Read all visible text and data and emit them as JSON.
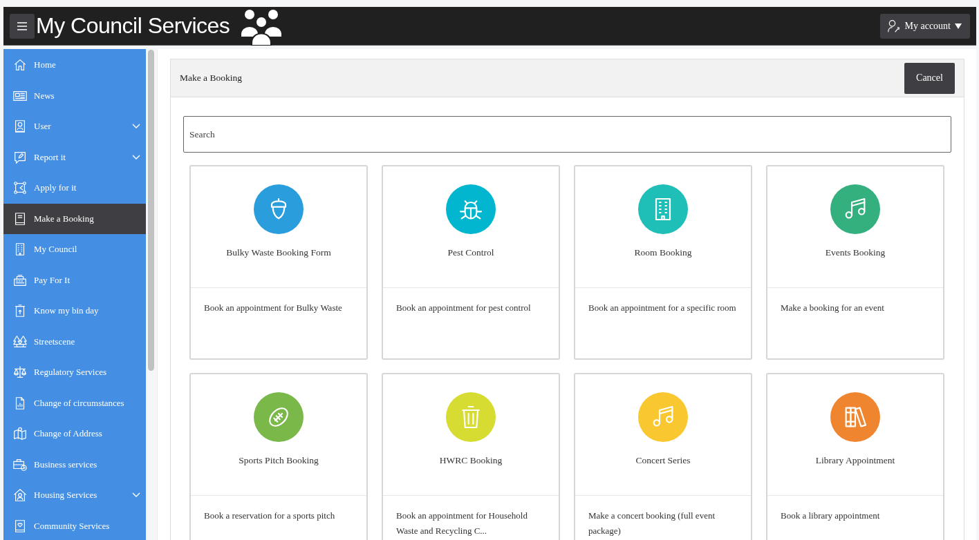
{
  "header": {
    "title": "My Council Services",
    "account_button": "My account"
  },
  "sidebar": {
    "items": [
      {
        "label": "Home",
        "kind": "home",
        "expandable": false,
        "selected": false
      },
      {
        "label": "News",
        "kind": "news",
        "expandable": false,
        "selected": false
      },
      {
        "label": "User",
        "kind": "user",
        "expandable": true,
        "selected": false
      },
      {
        "label": "Report it",
        "kind": "report",
        "expandable": true,
        "selected": false
      },
      {
        "label": "Apply for it",
        "kind": "apply",
        "expandable": false,
        "selected": false
      },
      {
        "label": "Make a Booking",
        "kind": "book",
        "expandable": false,
        "selected": true
      },
      {
        "label": "My Council",
        "kind": "building",
        "expandable": false,
        "selected": false
      },
      {
        "label": "Pay For It",
        "kind": "till",
        "expandable": false,
        "selected": false
      },
      {
        "label": "Know my bin day",
        "kind": "bin",
        "expandable": false,
        "selected": false
      },
      {
        "label": "Streetscene",
        "kind": "trees",
        "expandable": false,
        "selected": false
      },
      {
        "label": "Regulatory Services",
        "kind": "scales",
        "expandable": false,
        "selected": false
      },
      {
        "label": "Change of circumstances",
        "kind": "doc",
        "expandable": false,
        "selected": false
      },
      {
        "label": "Change of Address",
        "kind": "map",
        "expandable": false,
        "selected": false
      },
      {
        "label": "Business services",
        "kind": "briefcase",
        "expandable": false,
        "selected": false
      },
      {
        "label": "Housing Services",
        "kind": "house-user",
        "expandable": true,
        "selected": false
      },
      {
        "label": "Community Services",
        "kind": "heart-book",
        "expandable": false,
        "selected": false
      }
    ]
  },
  "panel": {
    "title": "Make a Booking",
    "cancel_button": "Cancel",
    "search": {
      "placeholder": "Search"
    },
    "cards": [
      {
        "title": "Bulky Waste Booking Form",
        "description": "Book an appointment for Bulky Waste",
        "kind": "acorn",
        "color": "#2a9edc"
      },
      {
        "title": "Pest Control",
        "description": "Book an appointment for pest control",
        "kind": "bug",
        "color": "#03b6cf"
      },
      {
        "title": "Room Booking",
        "description": "Book an appointment for a specific room",
        "kind": "building",
        "color": "#1fbfb8"
      },
      {
        "title": "Events Booking",
        "description": "Make a booking for an event",
        "kind": "music",
        "color": "#33b07e"
      },
      {
        "title": "Sports Pitch Booking",
        "description": "Book a reservation for a sports pitch",
        "kind": "football",
        "color": "#7ab84a"
      },
      {
        "title": "HWRC Booking",
        "description": "Book an appointment for Household Waste and Recycling C...",
        "kind": "trash",
        "color": "#d6dc31"
      },
      {
        "title": "Concert Series",
        "description": "Make a concert booking (full event package)",
        "kind": "music",
        "color": "#f9c72f"
      },
      {
        "title": "Library Appointment",
        "description": "Book a library appointment",
        "kind": "books",
        "color": "#f0852f"
      }
    ]
  }
}
